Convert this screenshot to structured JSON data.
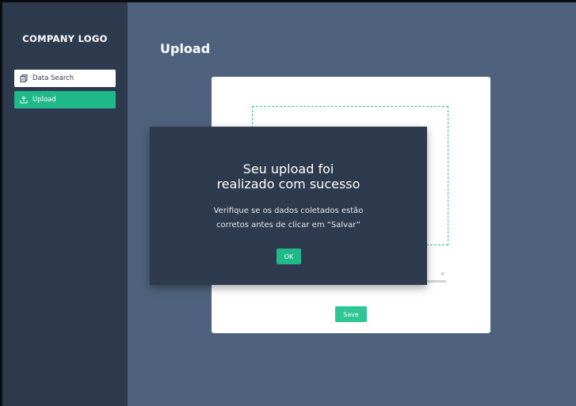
{
  "sidebar": {
    "logo": "COMPANY LOGO",
    "items": [
      {
        "label": "Data Search",
        "icon": "documents-icon"
      },
      {
        "label": "Upload",
        "icon": "upload-icon"
      }
    ]
  },
  "main": {
    "title": "Upload",
    "card": {
      "remove_symbol": "×",
      "save_label": "Save"
    }
  },
  "modal": {
    "title_line1": "Seu upload foi",
    "title_line2": "realizado com sucesso",
    "message_line1": "Verifique se os dados coletados estão",
    "message_line2": "corretos antes de clicar em “Salvar”",
    "ok_label": "OK"
  },
  "colors": {
    "sidebar": "#2e3a4d",
    "main": "#4f627d",
    "accent": "#1fb98a",
    "modal": "#2e3a4d"
  }
}
